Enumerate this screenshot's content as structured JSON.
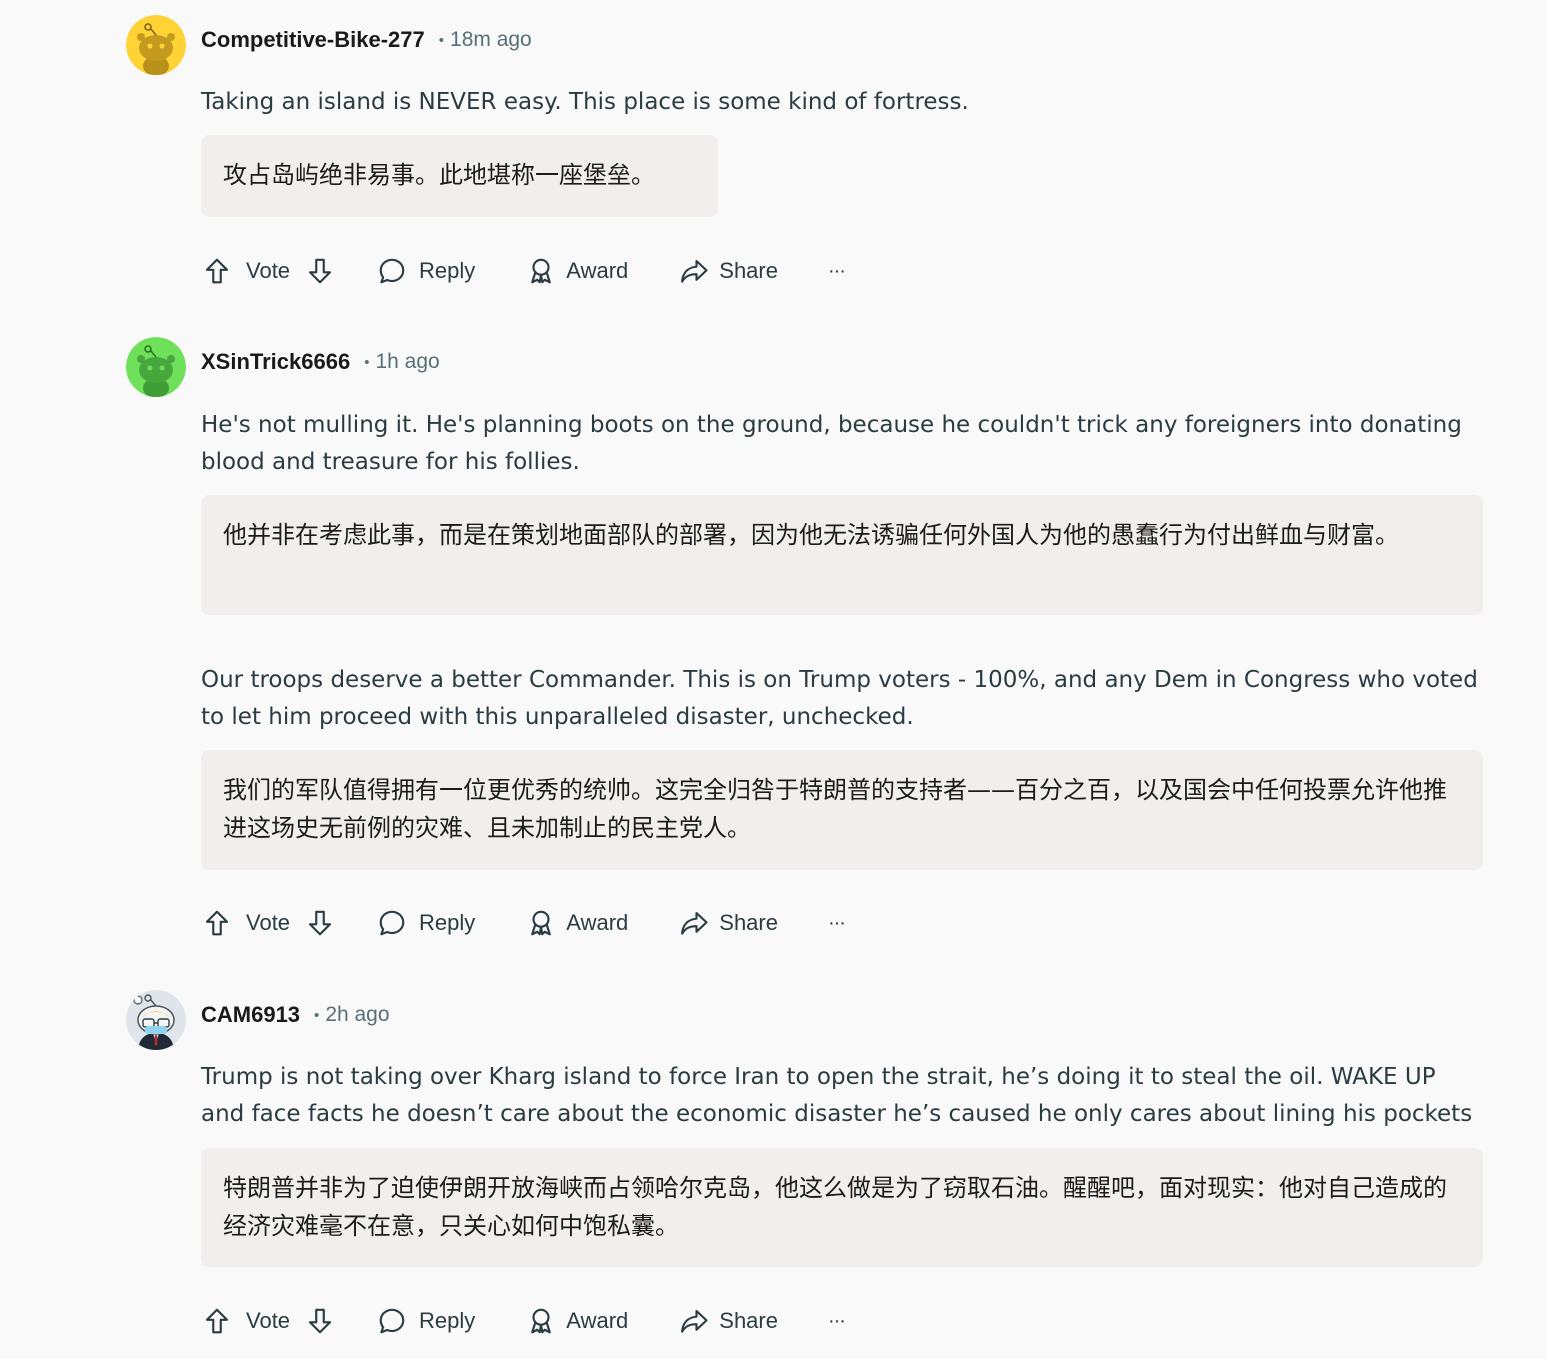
{
  "comments": [
    {
      "username": "Competitive-Bike-277",
      "dot": "•",
      "time": "18m ago",
      "avatar": "snoo-avatar-yellow",
      "paragraphs": [
        {
          "text": "Taking an island is NEVER easy. This place is some kind of fortress.",
          "translation": "攻占岛屿绝非易事。此地堪称一座堡垒。"
        }
      ]
    },
    {
      "username": "XSinTrick6666",
      "dot": "•",
      "time": "1h ago",
      "avatar": "snoo-avatar-green",
      "paragraphs": [
        {
          "text": "He's not mulling it. He's planning boots on the ground, because he couldn't trick any foreigners into donating blood and treasure for his follies.",
          "translation": "他并非在考虑此事，而是在策划地面部队的部署，因为他无法诱骗任何外国人为他的愚蠢行为付出鲜血与财富。"
        },
        {
          "text": "Our troops deserve a better Commander. This is on Trump voters - 100%, and any Dem in Congress who voted to let him proceed with this unparalleled disaster, unchecked.",
          "translation": "我们的军队值得拥有一位更优秀的统帅。这完全归咎于特朗普的支持者——百分之百，以及国会中任何投票允许他推进这场史无前例的灾难、且未加制止的民主党人。"
        }
      ]
    },
    {
      "username": "CAM6913",
      "dot": "•",
      "time": "2h ago",
      "avatar": "snoo-avatar-masked",
      "paragraphs": [
        {
          "text": "Trump is not taking over Kharg island to force Iran to open the strait, he’s doing it to steal the oil. WAKE UP and face facts he doesn’t care about the economic disaster he’s caused he only cares about lining his pockets",
          "translation": "特朗普并非为了迫使伊朗开放海峡而占领哈尔克岛，他这么做是为了窃取石油。醒醒吧，面对现实：他对自己造成的经济灾难毫不在意，只关心如何中饱私囊。"
        }
      ]
    }
  ],
  "actions": {
    "vote": "Vote",
    "reply": "Reply",
    "award": "Award",
    "share": "Share",
    "more": "···"
  },
  "colors": {
    "background": "#f9f9f9",
    "translation_bg": "#f3eeee",
    "meta_gray": "#576f76",
    "text": "#2a3c42"
  }
}
